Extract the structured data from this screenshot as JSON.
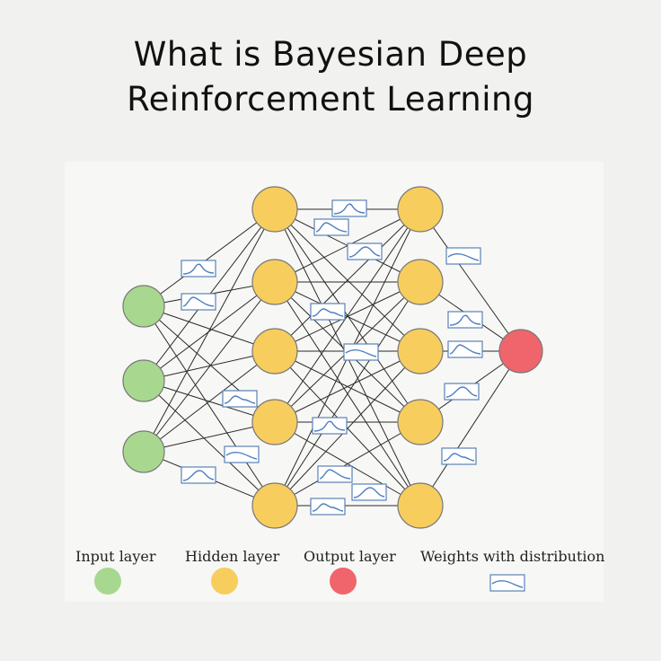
{
  "title": {
    "line1": "What is Bayesian Deep",
    "line2": "Reinforcement Learning"
  },
  "colors": {
    "input": "#a8d88f",
    "hidden": "#f7cd5e",
    "output": "#f0656b",
    "edge": "#2a2a2a",
    "weight_box": "#5a82b8",
    "curve": "#4f7fc0"
  },
  "network": {
    "layers": [
      {
        "role": "input",
        "nodes": 3
      },
      {
        "role": "hidden",
        "nodes": 5
      },
      {
        "role": "hidden",
        "nodes": 5
      },
      {
        "role": "output",
        "nodes": 1
      }
    ]
  },
  "legend": {
    "input": "Input layer",
    "hidden": "Hidden layer",
    "output": "Output layer",
    "weights": "Weights with distribution"
  }
}
